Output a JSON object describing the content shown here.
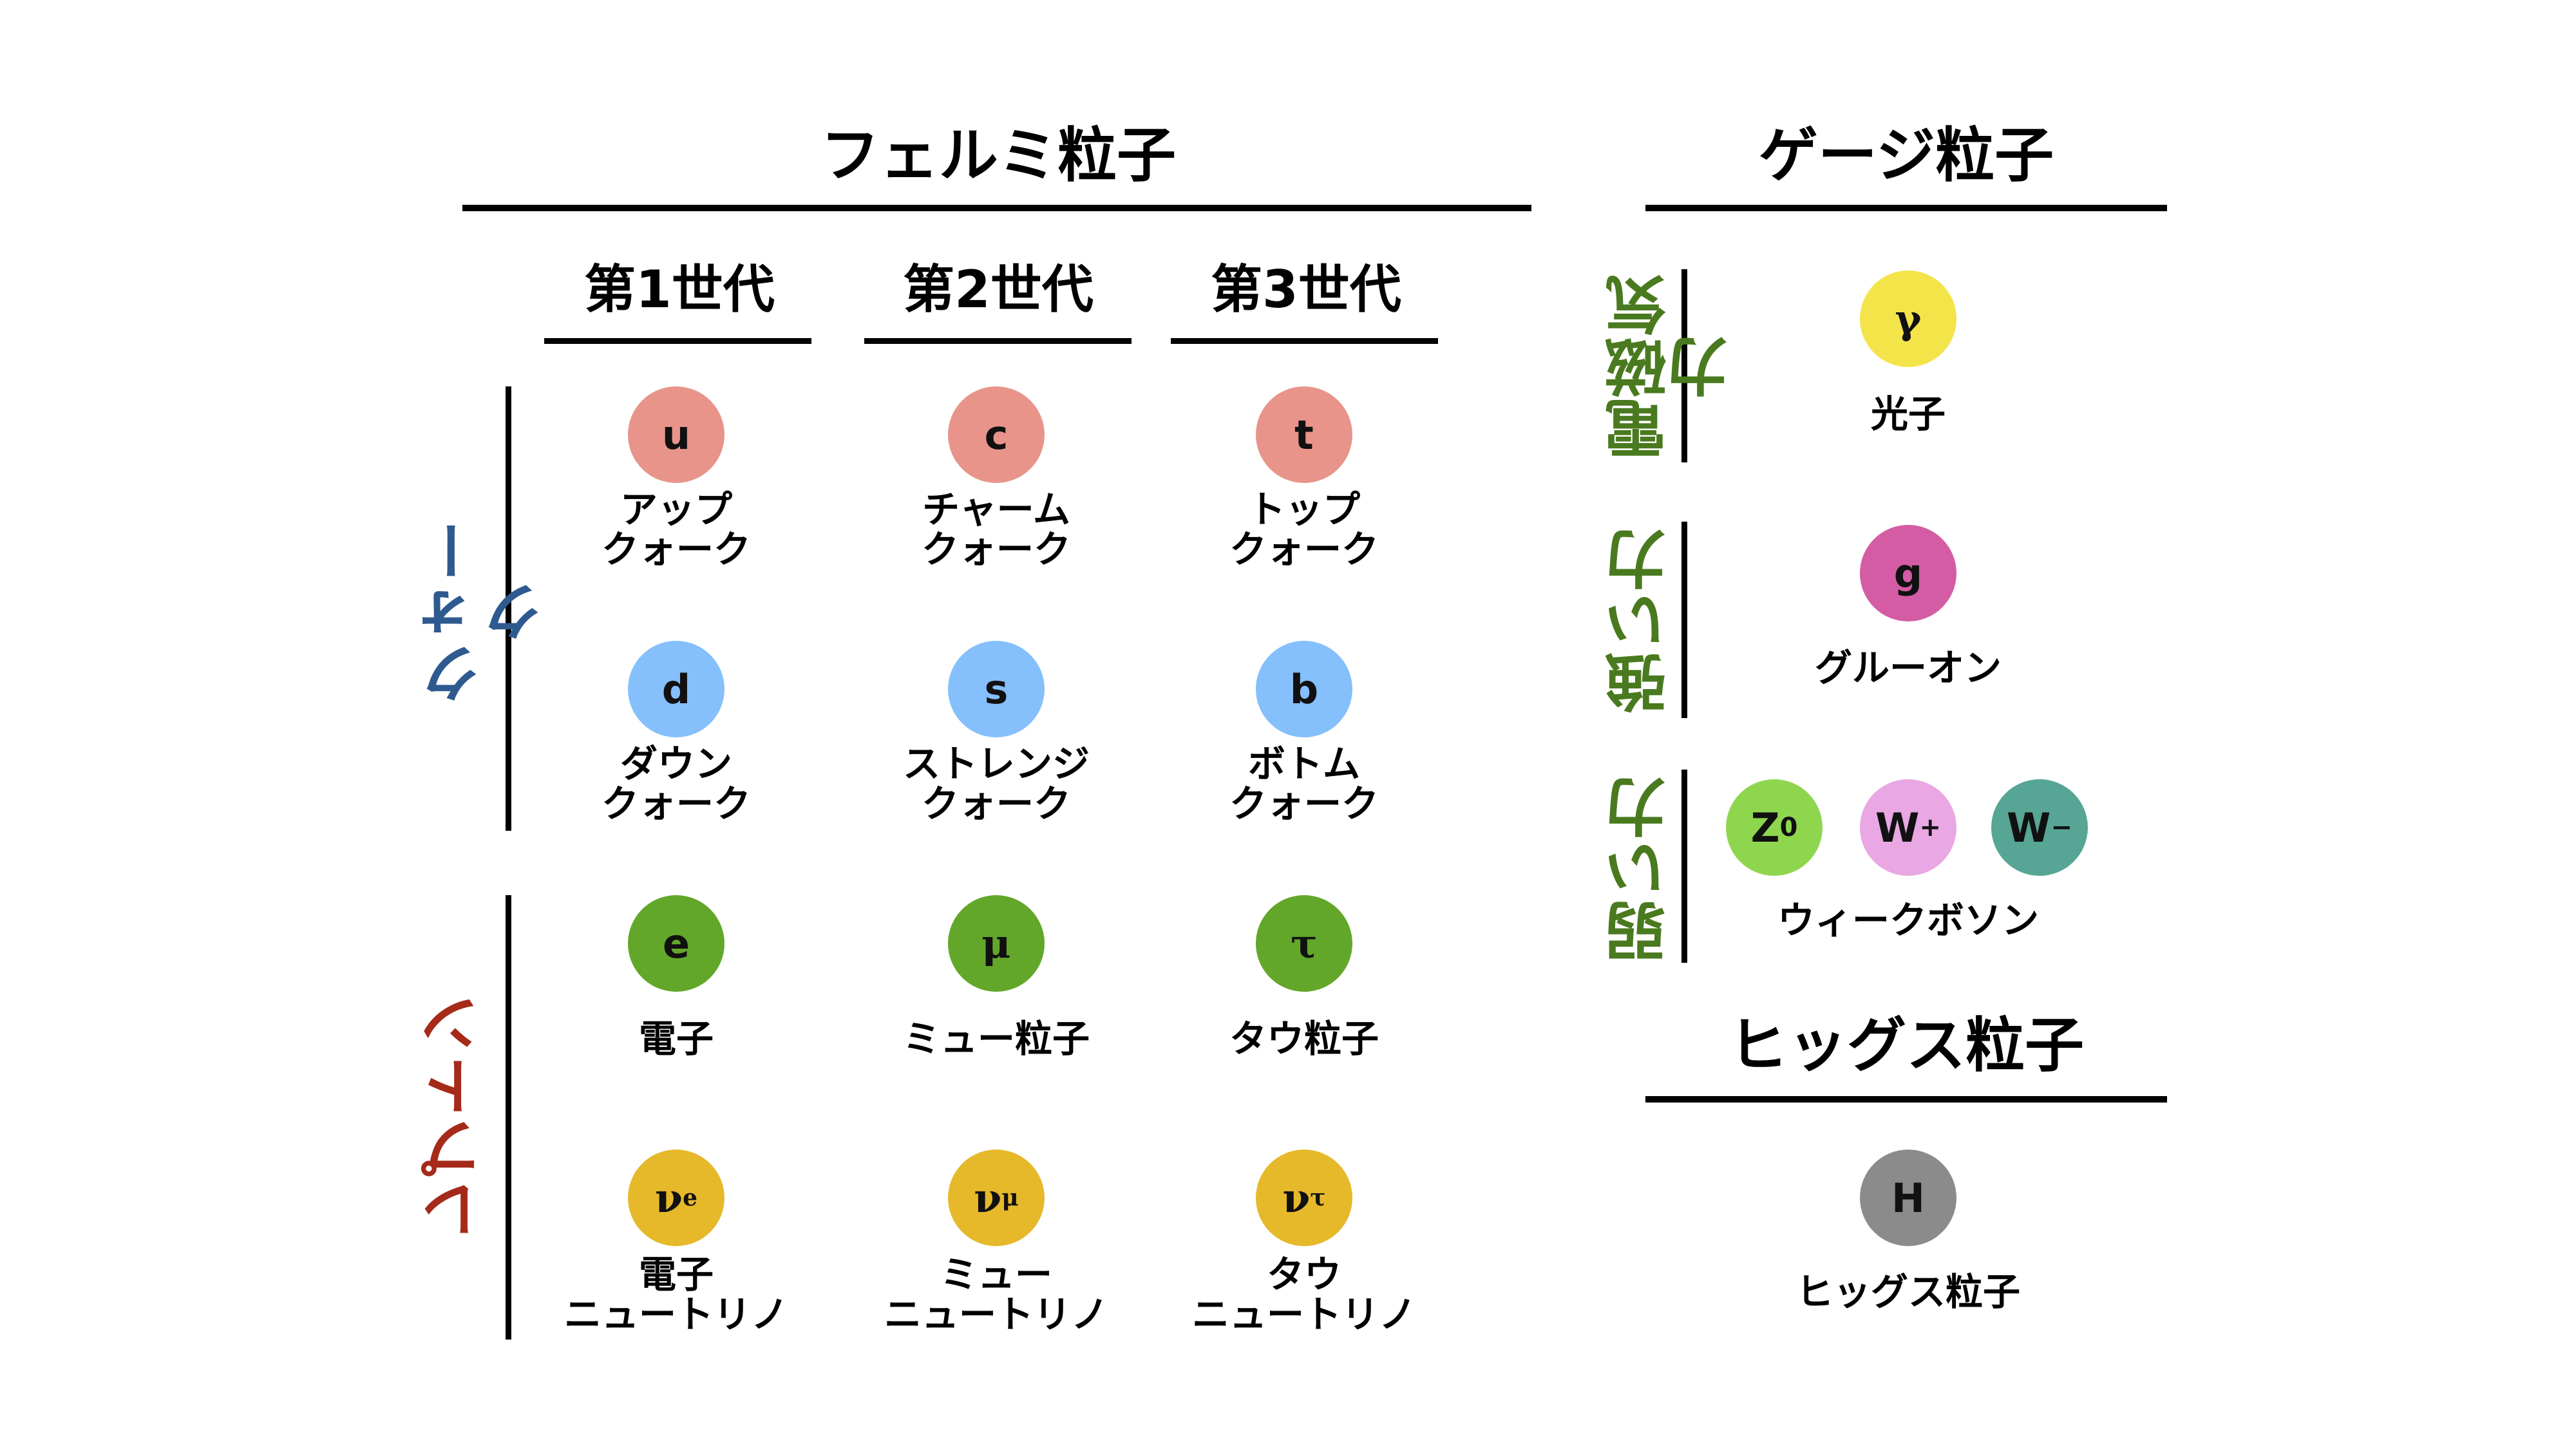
{
  "headings": {
    "fermion": "フェルミ粒子",
    "gauge": "ゲージ粒子",
    "higgs": "ヒッグス粒子"
  },
  "generations": [
    "第1世代",
    "第2世代",
    "第3世代"
  ],
  "groups": {
    "quark": "クォーク",
    "lepton": "レプトン"
  },
  "forces": {
    "em": "電磁気力",
    "strong": "強い力",
    "weak": "弱い力"
  },
  "particles": {
    "up": {
      "symbol": "u",
      "name1": "アップ",
      "name2": "クォーク",
      "color": "#e8948a"
    },
    "charm": {
      "symbol": "c",
      "name1": "チャーム",
      "name2": "クォーク",
      "color": "#e8948a"
    },
    "top": {
      "symbol": "t",
      "name1": "トップ",
      "name2": "クォーク",
      "color": "#e8948a"
    },
    "down": {
      "symbol": "d",
      "name1": "ダウン",
      "name2": "クォーク",
      "color": "#85bffc"
    },
    "strange": {
      "symbol": "s",
      "name1": "ストレンジ",
      "name2": "クォーク",
      "color": "#85bffc"
    },
    "bottom": {
      "symbol": "b",
      "name1": "ボトム",
      "name2": "クォーク",
      "color": "#85bffc"
    },
    "electron": {
      "symbol": "e",
      "name1": "電子",
      "name2": "",
      "color": "#62a72a"
    },
    "muon": {
      "symbol": "μ",
      "name1": "ミュー粒子",
      "name2": "",
      "color": "#62a72a"
    },
    "tau": {
      "symbol": "τ",
      "name1": "タウ粒子",
      "name2": "",
      "color": "#62a72a"
    },
    "nu_e": {
      "symbol": "ν",
      "sub": "e",
      "name1": "電子",
      "name2": "ニュートリノ",
      "color": "#e6b92b"
    },
    "nu_mu": {
      "symbol": "ν",
      "sub": "μ",
      "name1": "ミュー",
      "name2": "ニュートリノ",
      "color": "#e6b92b"
    },
    "nu_tau": {
      "symbol": "ν",
      "sub": "τ",
      "name1": "タウ",
      "name2": "ニュートリノ",
      "color": "#e6b92b"
    },
    "photon": {
      "symbol": "γ",
      "name1": "光子",
      "color": "#f3e44a"
    },
    "gluon": {
      "symbol": "g",
      "name1": "グルーオン",
      "color": "#d45ca4"
    },
    "z": {
      "symbol": "Z",
      "sup": "0",
      "color": "#8fd64f"
    },
    "wplus": {
      "symbol": "W",
      "sup": "+",
      "color": "#e9a7e3"
    },
    "wminus": {
      "symbol": "W",
      "sup": "−",
      "color": "#57a595"
    },
    "weak_name": "ウィークボソン",
    "higgs": {
      "symbol": "H",
      "name1": "ヒッグス粒子",
      "color": "#8b8b8b"
    }
  },
  "colors": {
    "quark_label": "#2e5a8f",
    "lepton_label": "#a52a1a",
    "force_label": "#4a7a1f",
    "line": "#000000"
  }
}
